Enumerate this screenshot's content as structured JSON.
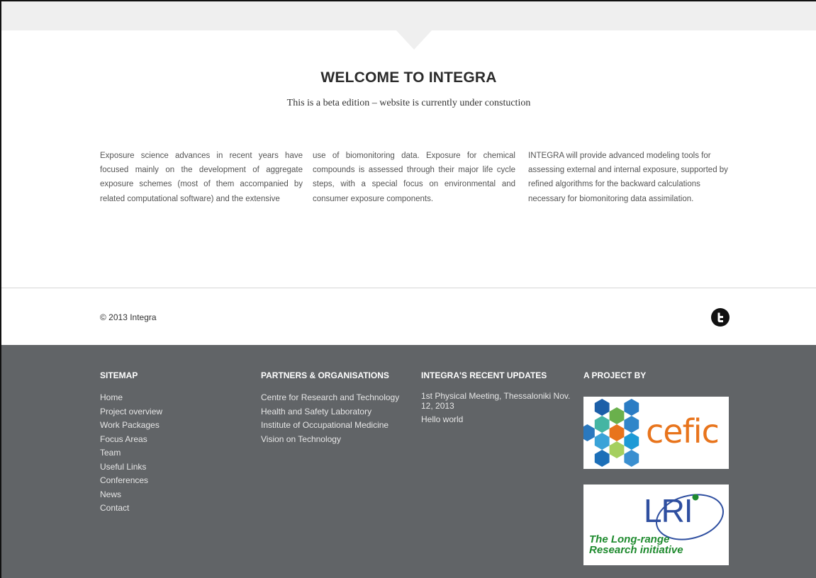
{
  "page": {
    "welcome_title": "WELCOME TO INTEGRA",
    "subtitle": "This is a beta edition – website is currently under constuction"
  },
  "intro": {
    "col1": "Exposure science advances in recent years have focused mainly on the development of aggregate exposure schemes (most of them accompanied by related computational software) and the extensive",
    "col2": "use of biomonitoring data. Exposure for chemical compounds is assessed through their major life cycle steps, with a special focus on environmental and consumer exposure components.",
    "col3": "INTEGRA will provide advanced modeling tools for assessing external and internal exposure, supported by refined algorithms for the backward calculations necessary for biomonitoring data assimilation."
  },
  "footer_bar": {
    "copyright": "© 2013 Integra",
    "social_icon": "twitter-icon"
  },
  "footer": {
    "sitemap": {
      "heading": "SITEMAP",
      "items": [
        "Home",
        "Project overview",
        "Work Packages",
        "Focus Areas",
        "Team",
        "Useful Links",
        "Conferences",
        "News",
        "Contact"
      ]
    },
    "partners": {
      "heading": "PARTNERS & ORGANISATIONS",
      "items": [
        "Centre for Research and Technology",
        "Health and Safety Laboratory",
        "Institute of Occupational Medicine",
        "Vision on Technology"
      ]
    },
    "updates": {
      "heading": "INTEGRA'S RECENT UPDATES",
      "items": [
        "1st Physical Meeting, Thessaloniki Nov. 12, 2013",
        "Hello world"
      ]
    },
    "project": {
      "heading": "A PROJECT BY",
      "logos": [
        {
          "wordmark": "cefic",
          "color": "#e8741c"
        },
        {
          "wordmark": "LRI",
          "tagline": "The Long-range Research initiative",
          "color": "#2f4fa0"
        }
      ]
    }
  },
  "colors": {
    "footer_bg": "#616467",
    "top_band": "#efefef",
    "cefic_orange": "#e8741c",
    "lri_blue": "#2f4fa0",
    "lri_green": "#1e8a2e"
  }
}
